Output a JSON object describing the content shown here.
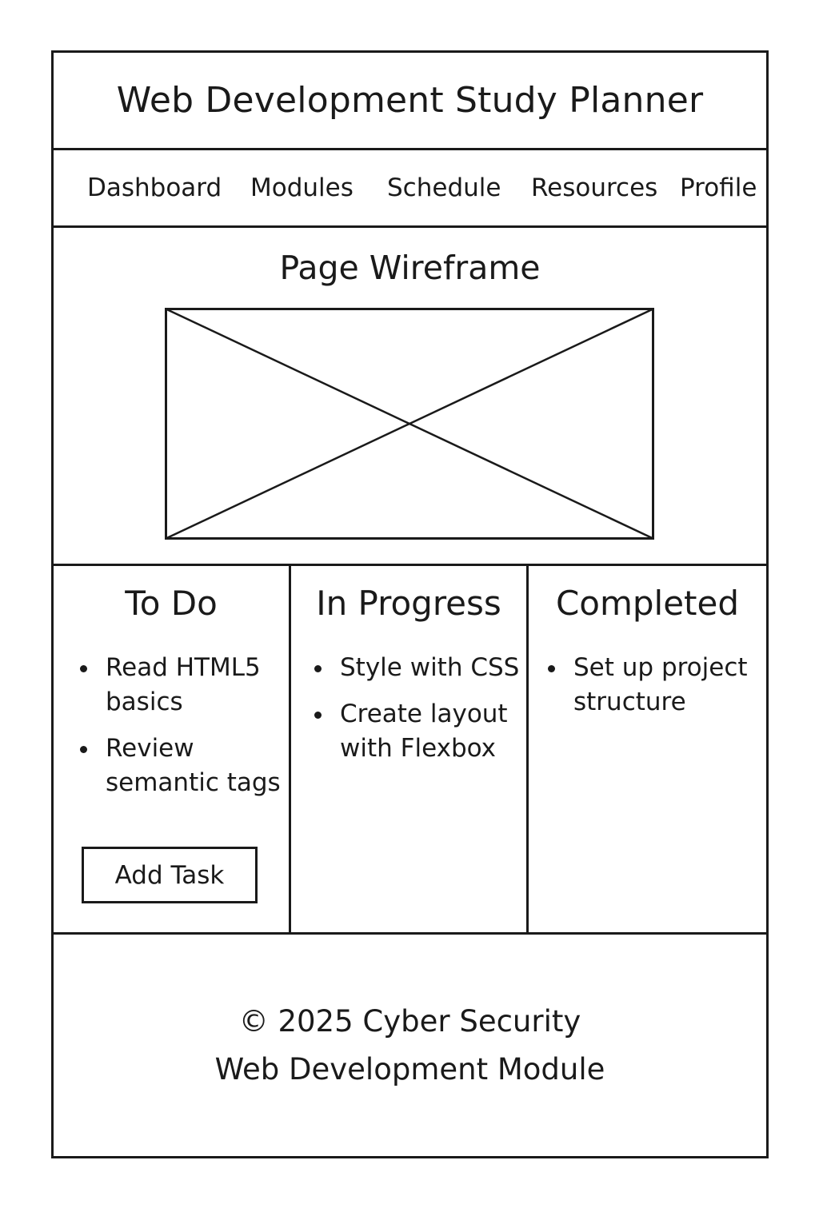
{
  "header": {
    "title": "Web Development Study Planner"
  },
  "nav": {
    "items": [
      {
        "label": "Dashboard"
      },
      {
        "label": "Modules"
      },
      {
        "label": "Schedule"
      },
      {
        "label": "Resources"
      },
      {
        "label": "Profile"
      }
    ]
  },
  "wireframe": {
    "title": "Page Wireframe",
    "placeholder_icon": "image-placeholder-cross"
  },
  "board": {
    "columns": [
      {
        "title": "To Do",
        "tasks": [
          {
            "line1": "Read HTML5",
            "line2": "basics"
          },
          {
            "line1": "Review",
            "line2": "semantic tags"
          }
        ],
        "button_label": "Add Task"
      },
      {
        "title": "In Progress",
        "tasks": [
          {
            "line1": "Style with CSS",
            "line2": ""
          },
          {
            "line1": "Create layout",
            "line2": "with Flexbox"
          }
        ]
      },
      {
        "title": "Completed",
        "tasks": [
          {
            "line1": "Set up project",
            "line2": "structure"
          }
        ]
      }
    ]
  },
  "footer": {
    "line1": "© 2025 Cyber Security",
    "line2": "Web Development Module"
  }
}
